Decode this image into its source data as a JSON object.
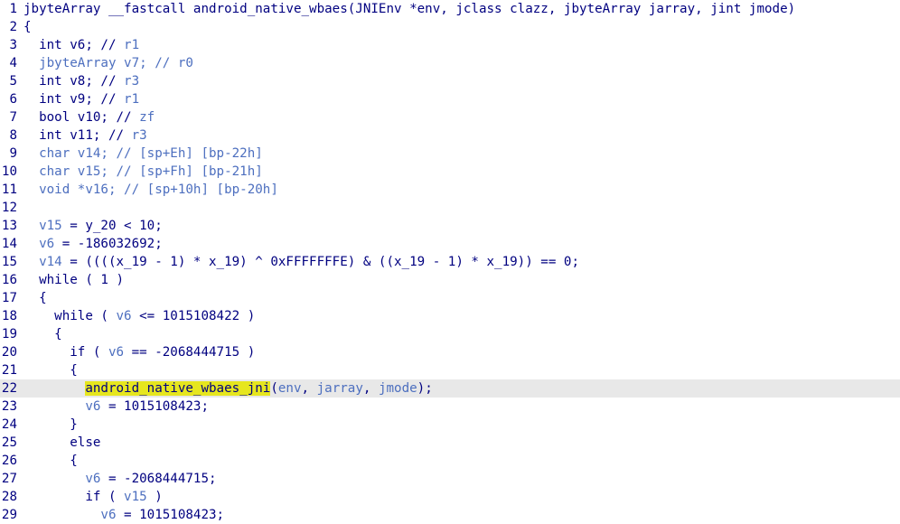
{
  "editor": {
    "lines": [
      {
        "num": "1",
        "tokens": [
          {
            "t": "jbyteArray __fastcall android_native_wbaes(JNIEnv *env, jclass clazz, jbyteArray jarray, jint jmode)",
            "c": "kw"
          }
        ]
      },
      {
        "num": "2",
        "tokens": [
          {
            "t": "{",
            "c": "kw"
          }
        ]
      },
      {
        "num": "3",
        "tokens": [
          {
            "t": "  int v6; // ",
            "c": "kw"
          },
          {
            "t": "r1",
            "c": "cmt"
          }
        ]
      },
      {
        "num": "4",
        "tokens": [
          {
            "t": "  jbyteArray v7; // ",
            "c": "var"
          },
          {
            "t": "r0",
            "c": "cmt"
          }
        ]
      },
      {
        "num": "5",
        "tokens": [
          {
            "t": "  int v8; // ",
            "c": "kw"
          },
          {
            "t": "r3",
            "c": "cmt"
          }
        ]
      },
      {
        "num": "6",
        "tokens": [
          {
            "t": "  int v9; // ",
            "c": "kw"
          },
          {
            "t": "r1",
            "c": "cmt"
          }
        ]
      },
      {
        "num": "7",
        "tokens": [
          {
            "t": "  bool v10; // ",
            "c": "kw"
          },
          {
            "t": "zf",
            "c": "cmt"
          }
        ]
      },
      {
        "num": "8",
        "tokens": [
          {
            "t": "  int v11; // ",
            "c": "kw"
          },
          {
            "t": "r3",
            "c": "cmt"
          }
        ]
      },
      {
        "num": "9",
        "tokens": [
          {
            "t": "  char v14; // ",
            "c": "var"
          },
          {
            "t": "[sp+Eh] [bp-22h]",
            "c": "cmt"
          }
        ]
      },
      {
        "num": "10",
        "tokens": [
          {
            "t": "  char v15; // ",
            "c": "var"
          },
          {
            "t": "[sp+Fh] [bp-21h]",
            "c": "cmt"
          }
        ]
      },
      {
        "num": "11",
        "tokens": [
          {
            "t": "  void *v16; // ",
            "c": "var"
          },
          {
            "t": "[sp+10h] [bp-20h]",
            "c": "cmt"
          }
        ]
      },
      {
        "num": "12",
        "tokens": []
      },
      {
        "num": "13",
        "tokens": [
          {
            "t": "  ",
            "c": "kw"
          },
          {
            "t": "v15",
            "c": "var"
          },
          {
            "t": " = y_20 < 10;",
            "c": "kw"
          }
        ]
      },
      {
        "num": "14",
        "tokens": [
          {
            "t": "  ",
            "c": "kw"
          },
          {
            "t": "v6",
            "c": "var"
          },
          {
            "t": " = -186032692;",
            "c": "kw"
          }
        ]
      },
      {
        "num": "15",
        "tokens": [
          {
            "t": "  ",
            "c": "kw"
          },
          {
            "t": "v14",
            "c": "var"
          },
          {
            "t": " = ((((x_19 - 1) * x_19) ^ 0xFFFFFFFE) & ((x_19 - 1) * x_19)) == 0;",
            "c": "kw"
          }
        ]
      },
      {
        "num": "16",
        "tokens": [
          {
            "t": "  while ( 1 )",
            "c": "kw"
          }
        ]
      },
      {
        "num": "17",
        "tokens": [
          {
            "t": "  {",
            "c": "kw"
          }
        ]
      },
      {
        "num": "18",
        "tokens": [
          {
            "t": "    while ( ",
            "c": "kw"
          },
          {
            "t": "v6",
            "c": "var"
          },
          {
            "t": " <= 1015108422 )",
            "c": "kw"
          }
        ]
      },
      {
        "num": "19",
        "tokens": [
          {
            "t": "    {",
            "c": "kw"
          }
        ]
      },
      {
        "num": "20",
        "tokens": [
          {
            "t": "      if ( ",
            "c": "kw"
          },
          {
            "t": "v6",
            "c": "var"
          },
          {
            "t": " == -2068444715 )",
            "c": "kw"
          }
        ]
      },
      {
        "num": "21",
        "tokens": [
          {
            "t": "      {",
            "c": "kw"
          }
        ]
      },
      {
        "num": "22",
        "highlight": true,
        "tokens": [
          {
            "t": "        ",
            "c": "kw"
          },
          {
            "t": "android_native_wbaes_jni",
            "c": "hlfn"
          },
          {
            "t": "(",
            "c": "kw"
          },
          {
            "t": "env",
            "c": "var"
          },
          {
            "t": ", ",
            "c": "kw"
          },
          {
            "t": "jarray",
            "c": "var"
          },
          {
            "t": ", ",
            "c": "kw"
          },
          {
            "t": "jmode",
            "c": "var"
          },
          {
            "t": ");",
            "c": "kw"
          }
        ]
      },
      {
        "num": "23",
        "tokens": [
          {
            "t": "        ",
            "c": "kw"
          },
          {
            "t": "v6",
            "c": "var"
          },
          {
            "t": " = 1015108423;",
            "c": "kw"
          }
        ]
      },
      {
        "num": "24",
        "tokens": [
          {
            "t": "      }",
            "c": "kw"
          }
        ]
      },
      {
        "num": "25",
        "tokens": [
          {
            "t": "      else",
            "c": "kw"
          }
        ]
      },
      {
        "num": "26",
        "tokens": [
          {
            "t": "      {",
            "c": "kw"
          }
        ]
      },
      {
        "num": "27",
        "tokens": [
          {
            "t": "        ",
            "c": "kw"
          },
          {
            "t": "v6",
            "c": "var"
          },
          {
            "t": " = -2068444715;",
            "c": "kw"
          }
        ]
      },
      {
        "num": "28",
        "tokens": [
          {
            "t": "        if ( ",
            "c": "kw"
          },
          {
            "t": "v15",
            "c": "var"
          },
          {
            "t": " )",
            "c": "kw"
          }
        ]
      },
      {
        "num": "29",
        "tokens": [
          {
            "t": "          ",
            "c": "kw"
          },
          {
            "t": "v6",
            "c": "var"
          },
          {
            "t": " = 1015108423;",
            "c": "kw"
          }
        ]
      }
    ]
  }
}
